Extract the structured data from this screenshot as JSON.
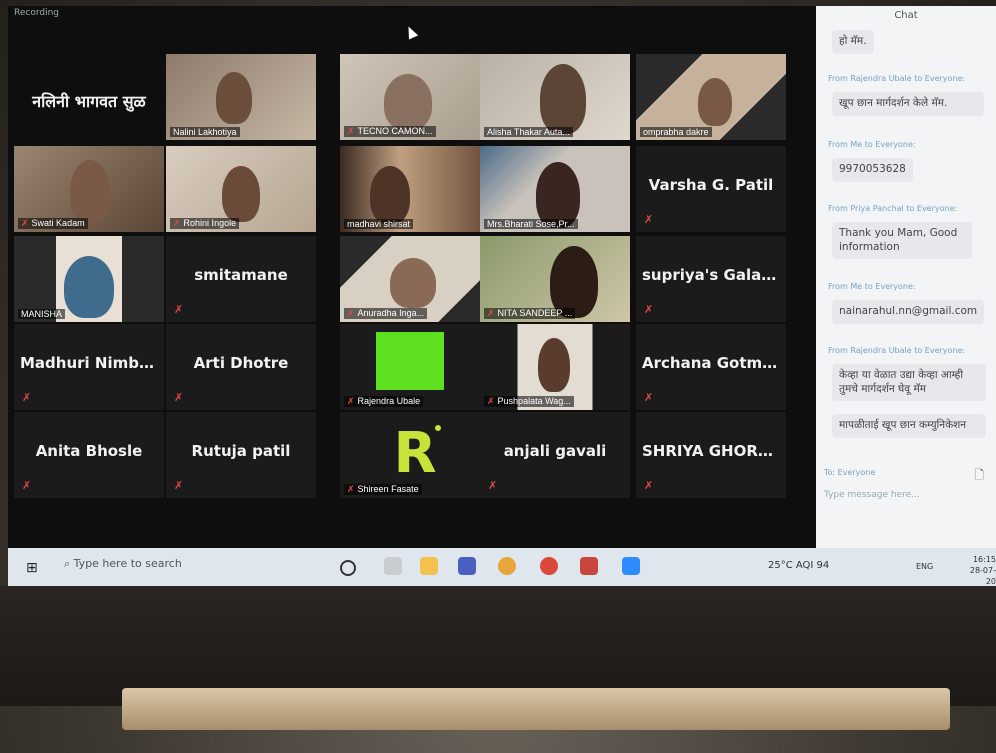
{
  "recording_label": "Recording",
  "name_banner": "नलिनी भागवत सुळ",
  "tiles": [
    {
      "name": "Nalini Lakhotiya"
    },
    {
      "name": "TECNO CAMON..."
    },
    {
      "name": "Alisha Thakar Auta..."
    },
    {
      "name": "omprabha dakre"
    },
    {
      "name": "Swati Kadam"
    },
    {
      "name": "Rohini Ingole"
    },
    {
      "name": "madhavi shirsat"
    },
    {
      "name": "Mrs.Bharati Sose,Pr..."
    },
    {
      "name": "Varsha G. Patil"
    },
    {
      "name": "MANISHA"
    },
    {
      "name": "smitamane"
    },
    {
      "name": "Anuradha Inga..."
    },
    {
      "name": "NITA SANDEEP ..."
    },
    {
      "name": "supriya's Galax..."
    },
    {
      "name": "Madhuri Nimba..."
    },
    {
      "name": "Arti Dhotre"
    },
    {
      "name": "Rajendra Ubale"
    },
    {
      "name": "Pushpalata Wag..."
    },
    {
      "name": "Archana Gotmu..."
    },
    {
      "name": "Anita Bhosle"
    },
    {
      "name": "Rutuja patil"
    },
    {
      "name": "Shireen Fasate"
    },
    {
      "name": "anjali gavali"
    },
    {
      "name": "SHRIYA GHORP..."
    }
  ],
  "chat": {
    "title": "Chat",
    "messages": [
      {
        "text": "हो मॅम."
      },
      {
        "from": "From Rajendra Ubale to Everyone:",
        "text": "खूप छान मार्गदर्शन केले मॅम."
      },
      {
        "from": "From Me to Everyone:",
        "text": "9970053628"
      },
      {
        "from": "From Priya Panchal to Everyone:",
        "text": "Thank you Mam, Good information"
      },
      {
        "from": "From Me to Everyone:",
        "text": "nainarahul.nn@gmail.com"
      },
      {
        "from": "From Rajendra Ubale to Everyone:",
        "text": "केव्हा या वेळात उद्या केव्हा आम्ही तुमचे मार्गदर्शन घेवू मॅम"
      },
      {
        "text": "मापळीताई खूप छान कम्युनिकेशन"
      }
    ],
    "to_label": "To: Everyone",
    "input_placeholder": "Type message here..."
  },
  "taskbar": {
    "search_placeholder": "Type here to search",
    "weather": "25°C AQI 94",
    "lang": "ENG",
    "time": "16:15",
    "date": "28-07-20"
  }
}
